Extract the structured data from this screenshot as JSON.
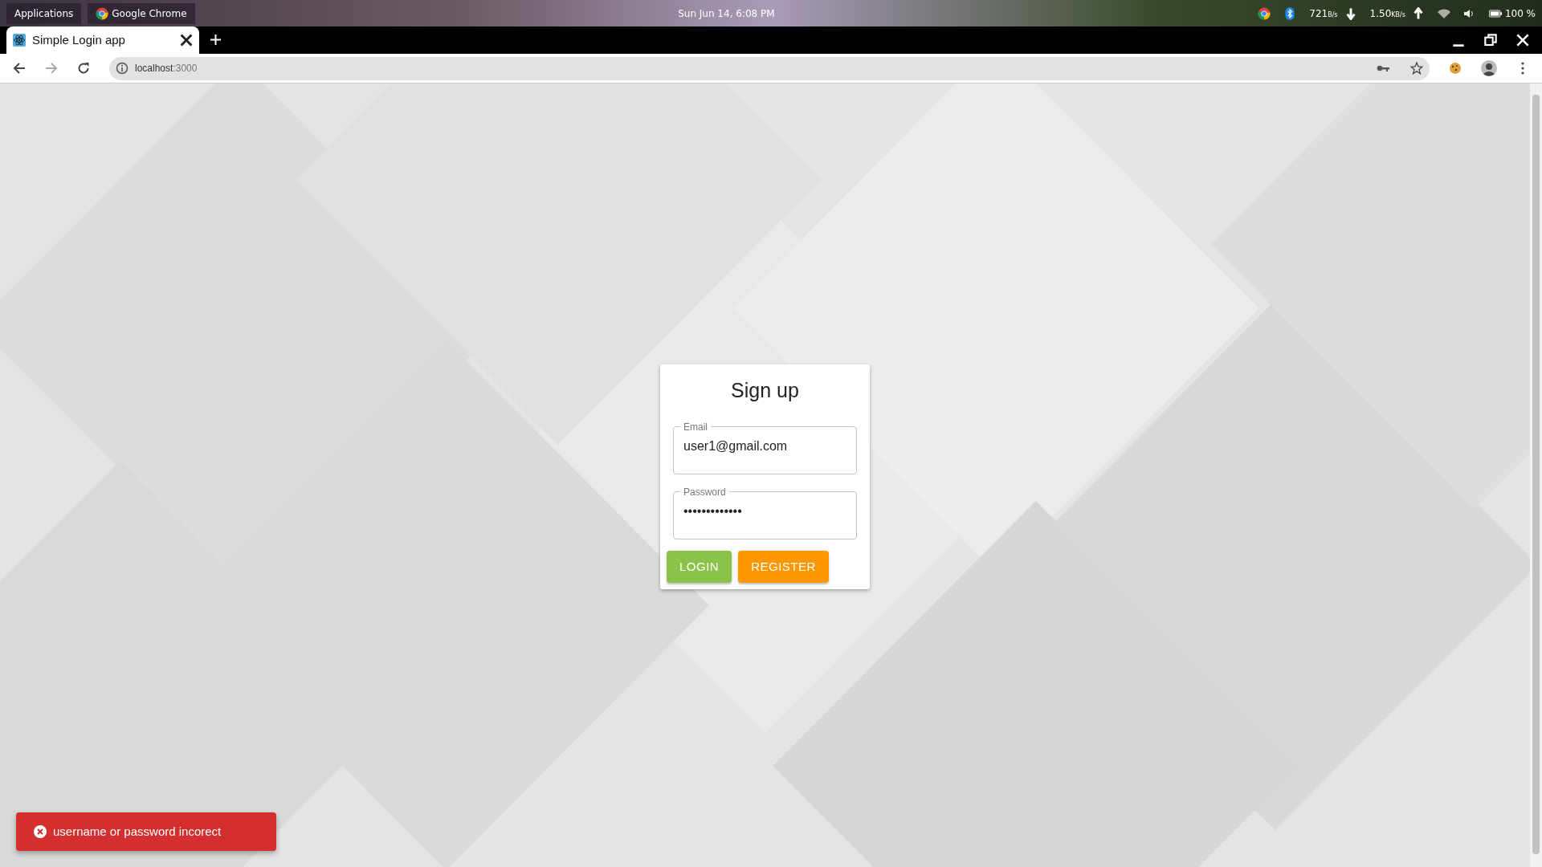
{
  "panel": {
    "menu": "Applications",
    "app": "Google Chrome",
    "clock": "Sun Jun 14, 6:08 PM",
    "net": [
      {
        "value": "721",
        "unit": "B/s",
        "kind": "download"
      },
      {
        "value": "1.50",
        "unit": "KB/s",
        "kind": "upload"
      }
    ],
    "battery": "100 %"
  },
  "tabs": [
    {
      "title": "Simple Login app",
      "selected": true
    }
  ],
  "address": {
    "host": "localhost",
    "port": ":3000"
  },
  "form": {
    "title": "Sign up",
    "fields": [
      {
        "label": "Email",
        "value": "user1@gmail.com"
      },
      {
        "label": "Password",
        "value": "•••••••••••••"
      }
    ],
    "buttons": [
      {
        "label": "LOGIN",
        "color": "#8bc34a"
      },
      {
        "label": "REGISTER",
        "color": "#ff9800"
      }
    ]
  },
  "toast": {
    "kind": "error",
    "message": "username or password incorect"
  }
}
